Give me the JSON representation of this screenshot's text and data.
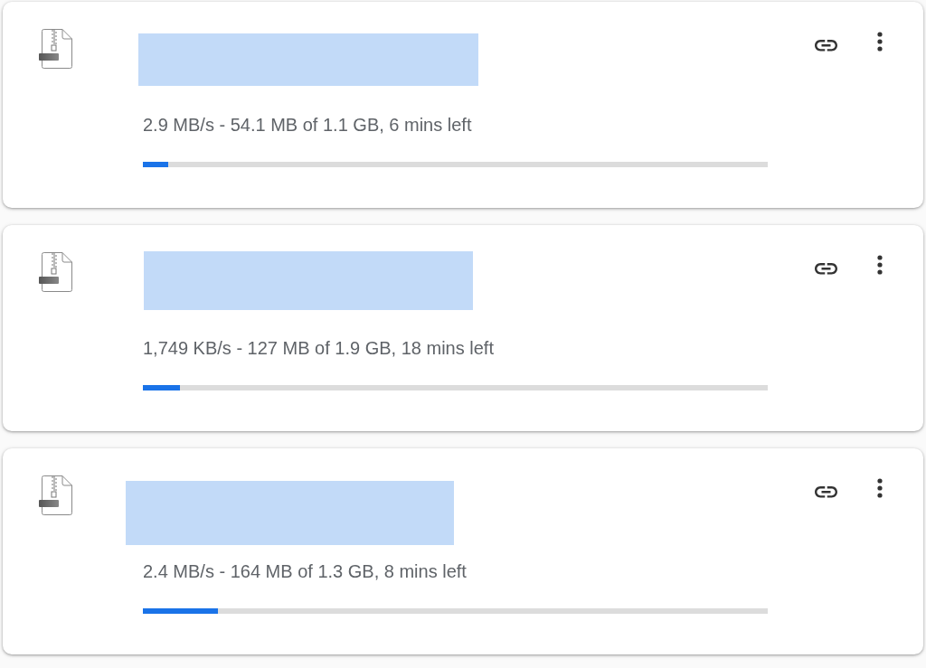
{
  "downloads": [
    {
      "redacted": true,
      "status": "2.9 MB/s - 54.1 MB of 1.1 GB, 6 mins left",
      "level": 0.04
    },
    {
      "redacted": true,
      "status": "1,749 KB/s - 127 MB of 1.9 GB, 18 mins left",
      "level": 0.06
    },
    {
      "redacted": true,
      "status": "2.4 MB/s - 164 MB of 1.3 GB, 8 mins left",
      "level": 0.12
    }
  ]
}
